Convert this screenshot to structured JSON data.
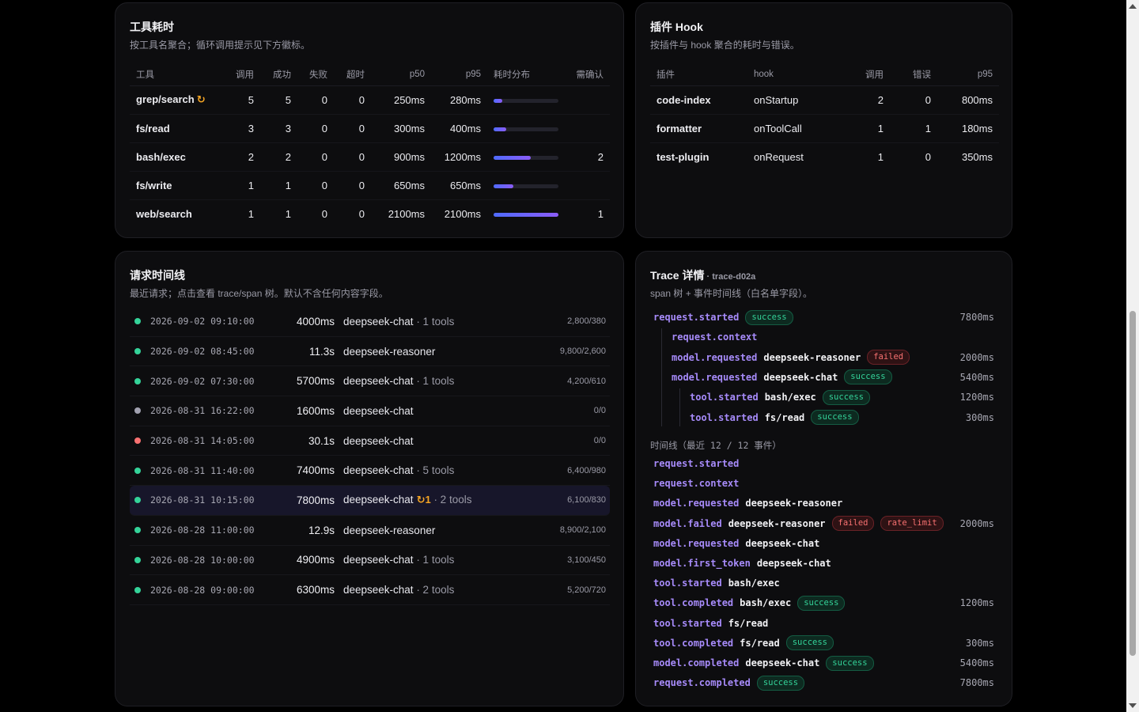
{
  "tool_card": {
    "title": "工具耗时",
    "subtitle": "按工具名聚合；循环调用提示见下方徽标。",
    "headers": [
      "工具",
      "调用",
      "成功",
      "失败",
      "超时",
      "p50",
      "p95",
      "耗时分布",
      "需确认"
    ],
    "rows": [
      {
        "name": "grep/search",
        "loop": "↻",
        "calls": "5",
        "ok": "5",
        "fail": "0",
        "timeout": "0",
        "p50": "250ms",
        "p95": "280ms",
        "dist": 0.13,
        "confirm": ""
      },
      {
        "name": "fs/read",
        "loop": "",
        "calls": "3",
        "ok": "3",
        "fail": "0",
        "timeout": "0",
        "p50": "300ms",
        "p95": "400ms",
        "dist": 0.19,
        "confirm": ""
      },
      {
        "name": "bash/exec",
        "loop": "",
        "calls": "2",
        "ok": "2",
        "fail": "0",
        "timeout": "0",
        "p50": "900ms",
        "p95": "1200ms",
        "dist": 0.57,
        "confirm": "2"
      },
      {
        "name": "fs/write",
        "loop": "",
        "calls": "1",
        "ok": "1",
        "fail": "0",
        "timeout": "0",
        "p50": "650ms",
        "p95": "650ms",
        "dist": 0.31,
        "confirm": ""
      },
      {
        "name": "web/search",
        "loop": "",
        "calls": "1",
        "ok": "1",
        "fail": "0",
        "timeout": "0",
        "p50": "2100ms",
        "p95": "2100ms",
        "dist": 1.0,
        "confirm": "1"
      }
    ]
  },
  "hook_card": {
    "title": "插件 Hook",
    "subtitle": "按插件与 hook 聚合的耗时与错误。",
    "headers": [
      "插件",
      "hook",
      "调用",
      "错误",
      "p95"
    ],
    "rows": [
      {
        "plugin": "code-index",
        "hook": "onStartup",
        "calls": "2",
        "errors": "0",
        "p95": "800ms"
      },
      {
        "plugin": "formatter",
        "hook": "onToolCall",
        "calls": "1",
        "errors": "1",
        "p95": "180ms"
      },
      {
        "plugin": "test-plugin",
        "hook": "onRequest",
        "calls": "1",
        "errors": "0",
        "p95": "350ms"
      }
    ]
  },
  "timeline_card": {
    "title": "请求时间线",
    "subtitle": "最近请求；点击查看 trace/span 树。默认不含任何内容字段。",
    "rows": [
      {
        "status": "ok",
        "time": "2026-09-02 09:10:00",
        "dur": "4000ms",
        "model": "deepseek-chat",
        "loop": "",
        "tools": " · 1 tools",
        "tokens": "2,800/380",
        "selected": false
      },
      {
        "status": "ok",
        "time": "2026-09-02 08:45:00",
        "dur": "11.3s",
        "model": "deepseek-reasoner",
        "loop": "",
        "tools": "",
        "tokens": "9,800/2,600",
        "selected": false
      },
      {
        "status": "ok",
        "time": "2026-09-02 07:30:00",
        "dur": "5700ms",
        "model": "deepseek-chat",
        "loop": "",
        "tools": " · 1 tools",
        "tokens": "4,200/610",
        "selected": false
      },
      {
        "status": "neutral",
        "time": "2026-08-31 16:22:00",
        "dur": "1600ms",
        "model": "deepseek-chat",
        "loop": "",
        "tools": "",
        "tokens": "0/0",
        "selected": false
      },
      {
        "status": "error",
        "time": "2026-08-31 14:05:00",
        "dur": "30.1s",
        "model": "deepseek-chat",
        "loop": "",
        "tools": "",
        "tokens": "0/0",
        "selected": false
      },
      {
        "status": "ok",
        "time": "2026-08-31 11:40:00",
        "dur": "7400ms",
        "model": "deepseek-chat",
        "loop": "",
        "tools": " · 5 tools",
        "tokens": "6,400/980",
        "selected": false
      },
      {
        "status": "ok",
        "time": "2026-08-31 10:15:00",
        "dur": "7800ms",
        "model": "deepseek-chat",
        "loop": "↻1",
        "tools": " · 2 tools",
        "tokens": "6,100/830",
        "selected": true
      },
      {
        "status": "ok",
        "time": "2026-08-28 11:00:00",
        "dur": "12.9s",
        "model": "deepseek-reasoner",
        "loop": "",
        "tools": "",
        "tokens": "8,900/2,100",
        "selected": false
      },
      {
        "status": "ok",
        "time": "2026-08-28 10:00:00",
        "dur": "4900ms",
        "model": "deepseek-chat",
        "loop": "",
        "tools": " · 1 tools",
        "tokens": "3,100/450",
        "selected": false
      },
      {
        "status": "ok",
        "time": "2026-08-28 09:00:00",
        "dur": "6300ms",
        "model": "deepseek-chat",
        "loop": "",
        "tools": " · 2 tools",
        "tokens": "5,200/720",
        "selected": false
      }
    ]
  },
  "trace_card": {
    "title": "Trace 详情",
    "trace_id": " · trace-d02a",
    "subtitle": "span 树 + 事件时间线（白名单字段）。",
    "tree": [
      {
        "depth": 0,
        "event": "request.started",
        "arg": "",
        "badges": [
          {
            "text": "success",
            "kind": "success"
          }
        ],
        "ms": "7800ms"
      },
      {
        "depth": 1,
        "event": "request.context",
        "arg": "",
        "badges": [],
        "ms": ""
      },
      {
        "depth": 1,
        "event": "model.requested",
        "arg": "deepseek-reasoner",
        "badges": [
          {
            "text": "failed",
            "kind": "failed"
          }
        ],
        "ms": "2000ms"
      },
      {
        "depth": 1,
        "event": "model.requested",
        "arg": "deepseek-chat",
        "badges": [
          {
            "text": "success",
            "kind": "success"
          }
        ],
        "ms": "5400ms"
      },
      {
        "depth": 2,
        "event": "tool.started",
        "arg": "bash/exec",
        "badges": [
          {
            "text": "success",
            "kind": "success"
          }
        ],
        "ms": "1200ms"
      },
      {
        "depth": 2,
        "event": "tool.started",
        "arg": "fs/read",
        "badges": [
          {
            "text": "success",
            "kind": "success"
          }
        ],
        "ms": "300ms"
      }
    ],
    "timeline_label": "时间线（最近 12 / 12 事件）",
    "events": [
      {
        "event": "request.started",
        "arg": "",
        "badges": [],
        "ms": ""
      },
      {
        "event": "request.context",
        "arg": "",
        "badges": [],
        "ms": ""
      },
      {
        "event": "model.requested",
        "arg": "deepseek-reasoner",
        "badges": [],
        "ms": ""
      },
      {
        "event": "model.failed",
        "arg": "deepseek-reasoner",
        "badges": [
          {
            "text": "failed",
            "kind": "failed"
          },
          {
            "text": "rate_limit",
            "kind": "failed"
          }
        ],
        "ms": "2000ms"
      },
      {
        "event": "model.requested",
        "arg": "deepseek-chat",
        "badges": [],
        "ms": ""
      },
      {
        "event": "model.first_token",
        "arg": "deepseek-chat",
        "badges": [],
        "ms": ""
      },
      {
        "event": "tool.started",
        "arg": "bash/exec",
        "badges": [],
        "ms": ""
      },
      {
        "event": "tool.completed",
        "arg": "bash/exec",
        "badges": [
          {
            "text": "success",
            "kind": "success"
          }
        ],
        "ms": "1200ms"
      },
      {
        "event": "tool.started",
        "arg": "fs/read",
        "badges": [],
        "ms": ""
      },
      {
        "event": "tool.completed",
        "arg": "fs/read",
        "badges": [
          {
            "text": "success",
            "kind": "success"
          }
        ],
        "ms": "300ms"
      },
      {
        "event": "model.completed",
        "arg": "deepseek-chat",
        "badges": [
          {
            "text": "success",
            "kind": "success"
          }
        ],
        "ms": "5400ms"
      },
      {
        "event": "request.completed",
        "arg": "",
        "badges": [
          {
            "text": "success",
            "kind": "success"
          }
        ],
        "ms": "7800ms"
      }
    ]
  },
  "colors": {
    "status_ok": "#34d399",
    "status_neutral": "#a1a1b0",
    "status_error": "#f87171",
    "accent": "#a78bfa"
  }
}
